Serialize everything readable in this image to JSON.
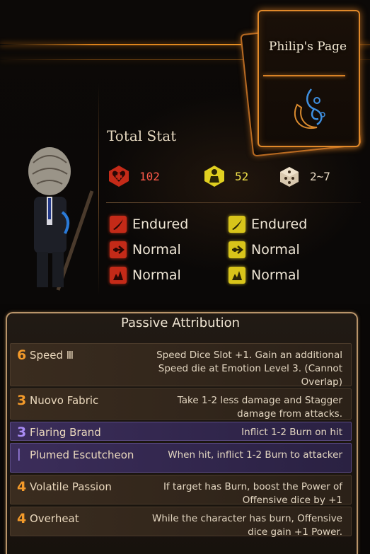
{
  "page": {
    "title": "Philip's Page"
  },
  "stats": {
    "title": "Total Stat",
    "hp": "102",
    "stagger": "52",
    "speed": "2~7"
  },
  "resistances": {
    "hp": [
      "Endured",
      "Normal",
      "Normal"
    ],
    "stagger": [
      "Endured",
      "Normal",
      "Normal"
    ]
  },
  "passives": {
    "header": "Passive Attribution",
    "items": [
      {
        "cost": "6",
        "name": "Speed Ⅲ",
        "desc": "Speed Dice Slot +1. Gain an additional Speed die at Emotion Level 3. (Cannot Overlap)",
        "style": "normal"
      },
      {
        "cost": "3",
        "name": "Nuovo Fabric",
        "desc": "Take 1-2 less damage and Stagger damage from attacks.",
        "style": "normal"
      },
      {
        "cost": "3",
        "name": "Flaring Brand",
        "desc": "Inflict 1-2 Burn on hit",
        "style": "purple"
      },
      {
        "cost": "|",
        "name": "Plumed Escutcheon",
        "desc": "When hit, inflict 1-2 Burn to attacker",
        "style": "purple"
      },
      {
        "cost": "4",
        "name": "Volatile Passion",
        "desc": "If target has Burn, boost the Power of Offensive dice by +1",
        "style": "normal"
      },
      {
        "cost": "4",
        "name": "Overheat",
        "desc": "While the character has burn, Offensive dice gain +1 Power.",
        "style": "normal"
      }
    ]
  },
  "colors": {
    "accent": "#e0892a",
    "hp_red": "#c42a18",
    "stagger_yellow": "#d8c41a",
    "cost_orange": "#f39a2a",
    "cost_purple": "#a98cf5"
  }
}
